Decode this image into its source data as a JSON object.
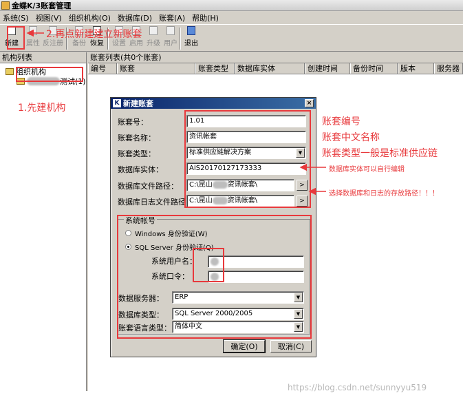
{
  "window": {
    "title": "金蝶K/3账套管理"
  },
  "menu": [
    "系统(S)",
    "视图(V)",
    "组织机构(O)",
    "数据库(D)",
    "账套(A)",
    "帮助(H)"
  ],
  "toolbar": [
    {
      "id": "new",
      "label": "新建",
      "icon": "new-document-icon",
      "enabled": true
    },
    {
      "id": "props",
      "label": "属性",
      "icon": "properties-icon",
      "enabled": false
    },
    {
      "id": "unreg",
      "label": "反注册",
      "icon": "unregister-icon",
      "enabled": false
    },
    {
      "id": "backup",
      "label": "备份",
      "icon": "backup-icon",
      "enabled": false
    },
    {
      "id": "restore",
      "label": "恢复",
      "icon": "restore-icon",
      "enabled": true
    },
    {
      "id": "settings",
      "label": "设置",
      "icon": "settings-icon",
      "enabled": false
    },
    {
      "id": "enable",
      "label": "启用",
      "icon": "enable-icon",
      "enabled": false
    },
    {
      "id": "upgrade",
      "label": "升级",
      "icon": "upgrade-icon",
      "enabled": false
    },
    {
      "id": "users",
      "label": "用户",
      "icon": "users-icon",
      "enabled": false
    },
    {
      "id": "exit",
      "label": "退出",
      "icon": "exit-icon",
      "enabled": true
    }
  ],
  "left_pane": {
    "title": "机构列表",
    "root": "组织机构",
    "child": "测试(1)"
  },
  "right_pane": {
    "title": "账套列表(共0个账套)",
    "columns": [
      "编号",
      "账套",
      "账套类型",
      "数据库实体",
      "创建时间",
      "备份时间",
      "版本",
      "服务器"
    ]
  },
  "dialog": {
    "title": "新建账套",
    "close": "×",
    "fields": {
      "code": {
        "label": "账套号：",
        "value": "1.01"
      },
      "name": {
        "label": "账套名称：",
        "value": "资讯帐套"
      },
      "type": {
        "label": "账套类型：",
        "value": "标准供应链解决方案"
      },
      "db_entity": {
        "label": "数据库实体：",
        "value": "AIS20170127173333"
      },
      "db_path": {
        "label": "数据库文件路径：",
        "value_a": "C:\\昆山",
        "value_b": "资讯帐套\\"
      },
      "log_path": {
        "label": "数据库日志文件路径：",
        "value_a": "C:\\昆山",
        "value_b": "资讯帐套\\"
      }
    },
    "sys_account": {
      "title": "系统帐号",
      "windows_auth": "Windows 身份验证(W)",
      "sql_auth": "SQL Server 身份验证(Q)",
      "username_label": "系统用户名：",
      "password_label": "系统口令：",
      "server_label": "数据服务器：",
      "server_value": "ERP",
      "dbtype_label": "数据库类型：",
      "dbtype_value": "SQL Server 2000/2005",
      "lang_label": "账套语言类型：",
      "lang_value": "简体中文"
    },
    "ok": "确定(O)",
    "cancel": "取消(C)"
  },
  "annotations": {
    "step1": "1.先建机构",
    "step2": "2.再点新建建立新账套",
    "code_note": "账套编号",
    "name_note": "账套中文名称",
    "type_note": "账套类型一般是标准供应链",
    "entity_note": "数据库实体可以自行编辑",
    "path_note": "选择数据库和日志的存放路径！！！",
    "color": "#e8393c"
  },
  "watermark": "https://blog.csdn.net/sunnyyu519"
}
